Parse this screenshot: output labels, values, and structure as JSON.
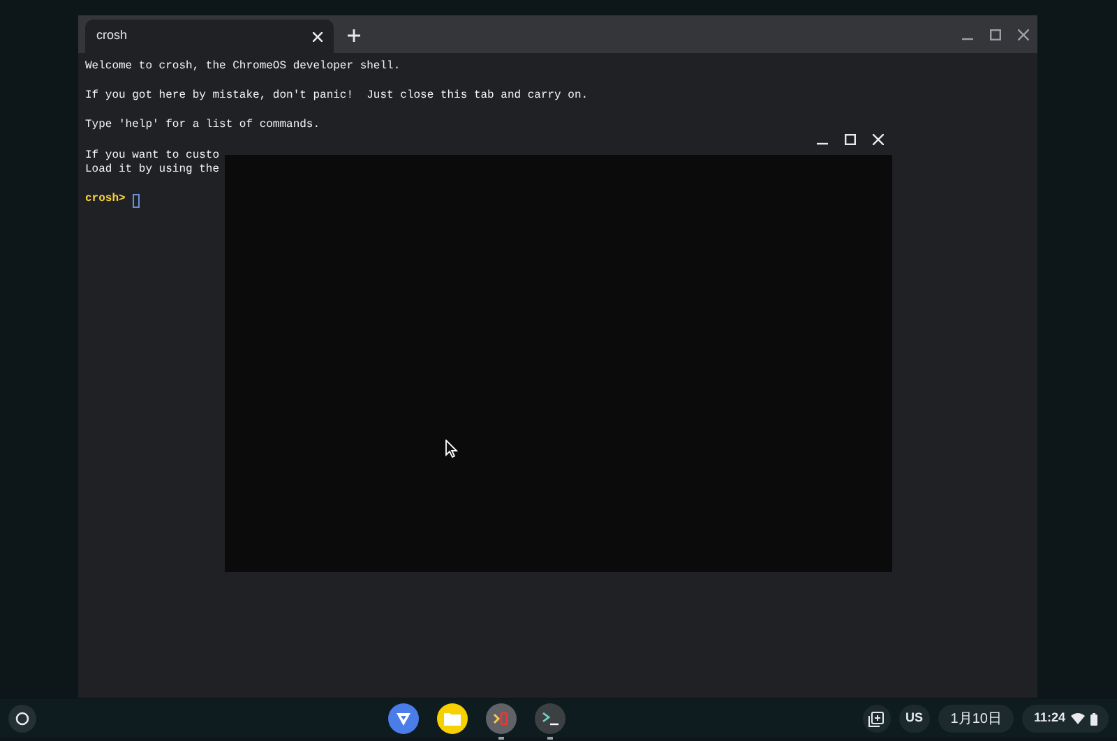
{
  "browser": {
    "tabs": [
      {
        "label": "crosh",
        "selected": true
      }
    ]
  },
  "terminal": {
    "paragraphs": [
      [
        "Welcome to crosh, the ChromeOS developer shell."
      ],
      [
        "If you got here by mistake, don't panic!  Just close this tab and carry on."
      ],
      [
        "Type 'help' for a list of commands."
      ],
      [
        "If you want to custo",
        "Load it by using the"
      ]
    ],
    "prompt": "crosh>"
  },
  "shelf": {
    "apps": [
      {
        "kind": "triangle",
        "running": false
      },
      {
        "kind": "files",
        "running": false
      },
      {
        "kind": "crosh",
        "running": true
      },
      {
        "kind": "terminal",
        "running": true
      }
    ],
    "ime": "US",
    "date": "1月10日",
    "time": "11:24"
  }
}
